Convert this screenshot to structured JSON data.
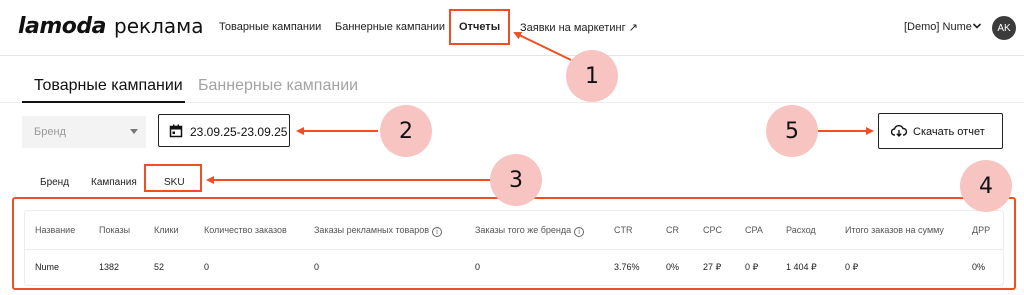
{
  "header": {
    "logo_main": "lamoda",
    "logo_sub": "реклама",
    "nav": [
      {
        "label": "Товарные кампании"
      },
      {
        "label": "Баннерные кампании"
      },
      {
        "label": "Отчеты"
      },
      {
        "label": "Заявки на маркетинг ↗"
      }
    ],
    "user_label": "[Demo] Nume",
    "avatar_initials": "AK"
  },
  "main_tabs": [
    {
      "label": "Товарные кампании"
    },
    {
      "label": "Баннерные кампании"
    }
  ],
  "filters": {
    "brand_placeholder": "Бренд",
    "date_range": "23.09.25-23.09.25",
    "download_label": "Скачать отчет"
  },
  "sub_tabs": [
    {
      "label": "Бренд"
    },
    {
      "label": "Кампания"
    },
    {
      "label": "SKU"
    }
  ],
  "table": {
    "columns": [
      "Название",
      "Показы",
      "Клики",
      "Количество заказов",
      "Заказы рекламных товаров",
      "Заказы того же бренда",
      "CTR",
      "CR",
      "CPC",
      "CPA",
      "Расход",
      "Итого заказов на сумму",
      "ДРР"
    ],
    "rows": [
      [
        "Nume",
        "1382",
        "52",
        "0",
        "0",
        "0",
        "3.76%",
        "0%",
        "27 ₽",
        "0 ₽",
        "1 404 ₽",
        "0 ₽",
        "0%"
      ]
    ]
  },
  "annotations": {
    "callouts": [
      "1",
      "2",
      "3",
      "4",
      "5"
    ],
    "accent_color": "#f04e23",
    "callout_color": "#f8c4c1"
  }
}
